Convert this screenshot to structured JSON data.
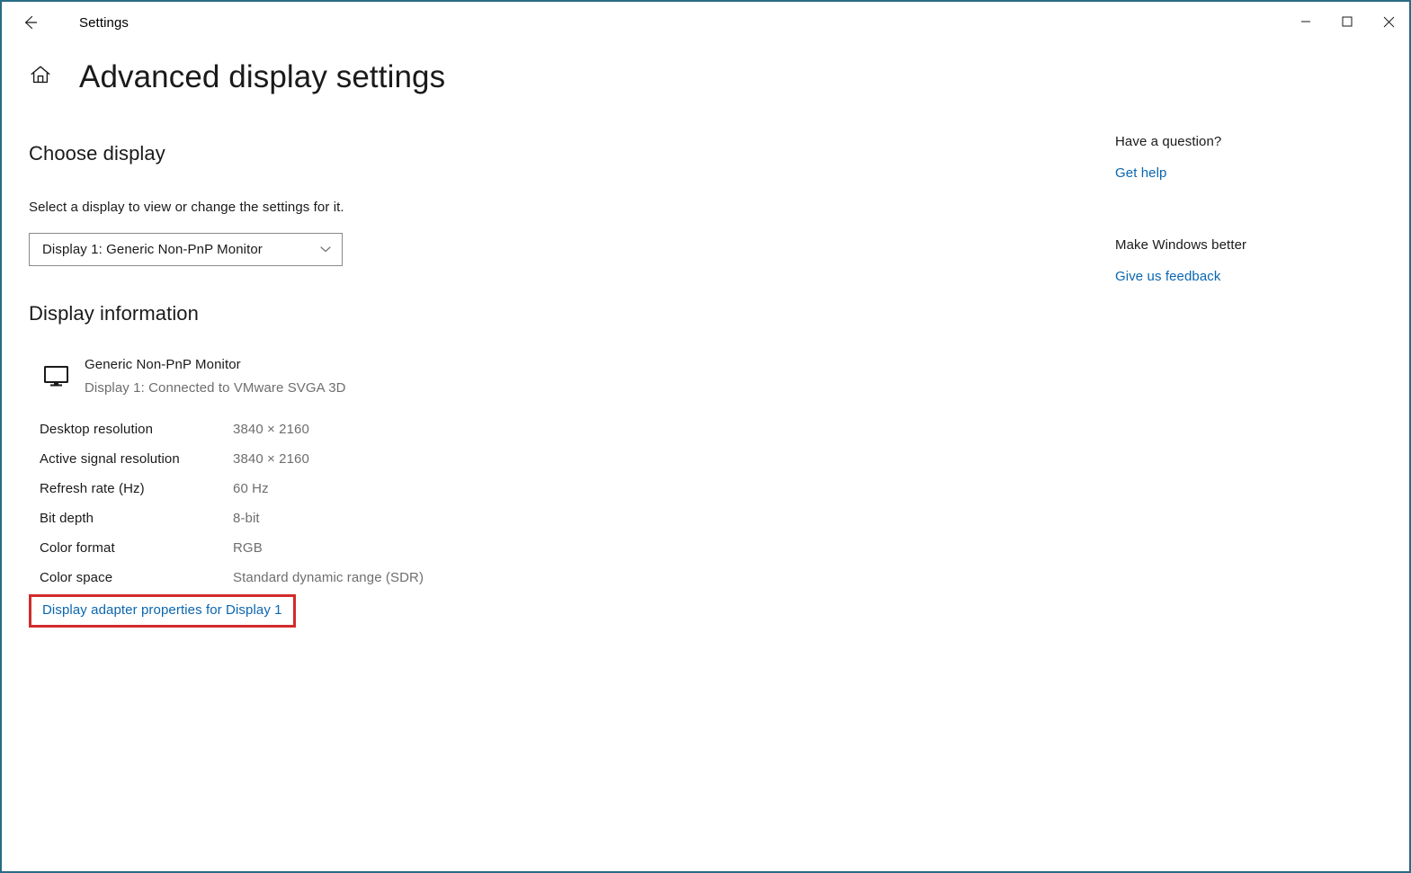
{
  "window": {
    "border_color": "#2a6b85",
    "background": "#ffffff"
  },
  "titlebar": {
    "back_icon": "back-arrow-icon",
    "app_title": "Settings",
    "minimize_icon": "minimize-icon",
    "maximize_icon": "maximize-icon",
    "close_icon": "close-icon"
  },
  "header": {
    "home_icon": "home-icon",
    "title": "Advanced display settings"
  },
  "choose_display": {
    "heading": "Choose display",
    "description": "Select a display to view or change the settings for it.",
    "dropdown": {
      "selected": "Display 1: Generic Non-PnP Monitor",
      "chevron_icon": "chevron-down-icon",
      "options": [
        "Display 1: Generic Non-PnP Monitor"
      ]
    }
  },
  "display_information": {
    "heading": "Display information",
    "monitor_icon": "monitor-icon",
    "monitor_name": "Generic Non-PnP Monitor",
    "monitor_connection": "Display 1: Connected to VMware SVGA 3D",
    "rows": [
      {
        "label": "Desktop resolution",
        "value": "3840 × 2160"
      },
      {
        "label": "Active signal resolution",
        "value": "3840 × 2160"
      },
      {
        "label": "Refresh rate (Hz)",
        "value": "60 Hz"
      },
      {
        "label": "Bit depth",
        "value": "8-bit"
      },
      {
        "label": "Color format",
        "value": "RGB"
      },
      {
        "label": "Color space",
        "value": "Standard dynamic range (SDR)"
      }
    ],
    "adapter_link": "Display adapter properties for Display 1",
    "adapter_link_highlight_color": "#d22b2b"
  },
  "right_rail": {
    "question_heading": "Have a question?",
    "get_help_link": "Get help",
    "feedback_heading": "Make Windows better",
    "feedback_link": "Give us feedback"
  },
  "colors": {
    "link": "#0a66b0",
    "text_primary": "#1a1a1a",
    "text_secondary": "#6e6e6e",
    "highlight": "#d22b2b",
    "window_border": "#2a6b85"
  }
}
